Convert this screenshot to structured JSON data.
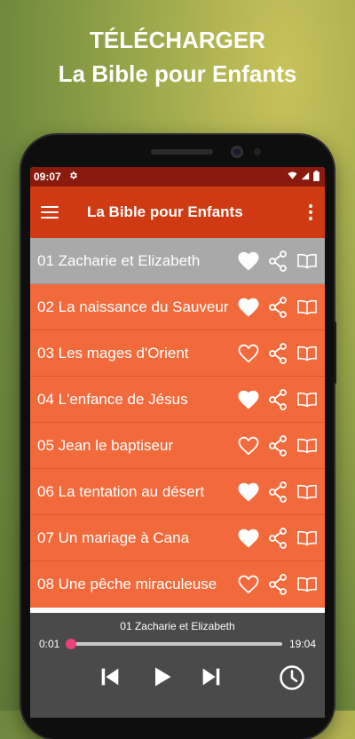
{
  "promo": {
    "line1": "TÉLÉCHARGER",
    "line2": "La Bible pour Enfants"
  },
  "statusbar": {
    "time": "09:07",
    "icons": [
      "gear-icon",
      "wifi-icon",
      "signal-icon",
      "battery-icon"
    ]
  },
  "toolbar": {
    "title": "La Bible pour Enfants",
    "menu_icon": "hamburger-menu-icon",
    "overflow_icon": "more-vert-icon"
  },
  "colors": {
    "status_bar": "#8b1a0e",
    "toolbar": "#cf3a12",
    "row": "#f26a3b",
    "row_selected": "#a9a9a9",
    "player_bg": "#3c3c3c",
    "accent": "#f0407a"
  },
  "episodes": [
    {
      "label": "01 Zacharie et Elizabeth",
      "favorite": true,
      "selected": true
    },
    {
      "label": "02 La naissance du Sauveur",
      "favorite": true,
      "selected": false
    },
    {
      "label": "03 Les mages d'Orient",
      "favorite": false,
      "selected": false
    },
    {
      "label": "04 L'enfance de Jésus",
      "favorite": true,
      "selected": false
    },
    {
      "label": "05 Jean le baptiseur",
      "favorite": false,
      "selected": false
    },
    {
      "label": "06 La tentation au désert",
      "favorite": true,
      "selected": false
    },
    {
      "label": "07 Un mariage à Cana",
      "favorite": true,
      "selected": false
    },
    {
      "label": "08 Une pêche miraculeuse",
      "favorite": false,
      "selected": false
    }
  ],
  "player": {
    "title": "01 Zacharie et Elizabeth",
    "current_time": "0:01",
    "total_time": "19:04",
    "progress": 0.001
  }
}
